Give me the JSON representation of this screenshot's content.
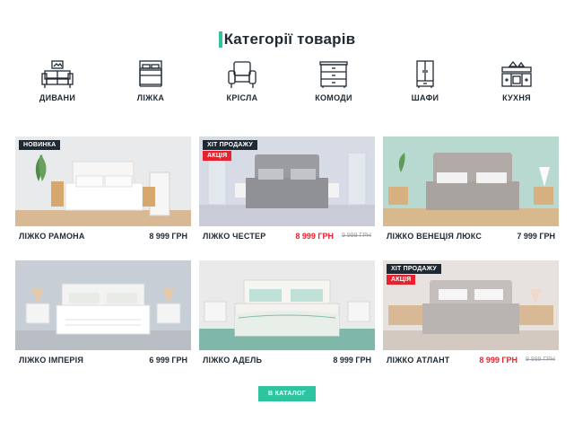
{
  "page": {
    "title": "Категорії товарів",
    "title_first_letter": "К",
    "title_rest": "атегорії товарів"
  },
  "categories": [
    {
      "label": "ДИВАНИ",
      "icon": "sofa-icon"
    },
    {
      "label": "ЛІЖКА",
      "icon": "bed-icon"
    },
    {
      "label": "КРІСЛА",
      "icon": "armchair-icon"
    },
    {
      "label": "КОМОДИ",
      "icon": "dresser-icon"
    },
    {
      "label": "ШАФИ",
      "icon": "wardrobe-icon"
    },
    {
      "label": "КУХНЯ",
      "icon": "kitchen-icon"
    }
  ],
  "products": [
    {
      "name": "ЛІЖКО РАМОНА",
      "price": "8 999 ГРН",
      "old_price": "",
      "badges": [
        "НОВИНКА"
      ],
      "wall": "#e9eaec",
      "bed": "#f2f2f0",
      "floor": "#d9b993"
    },
    {
      "name": "ЛІЖКО ЧЕСТЕР",
      "price": "8 999 ГРН",
      "old_price": "9 999 ГРН",
      "badges": [
        "ХІТ ПРОДАЖУ",
        "АКЦІЯ"
      ],
      "wall": "#d6dbe6",
      "bed": "#8f9196",
      "floor": "#c9ccd6"
    },
    {
      "name": "ЛІЖКО ВЕНЕЦІЯ ЛЮКС",
      "price": "7 999 ГРН",
      "old_price": "",
      "badges": [],
      "wall": "#b8d9cf",
      "bed": "#a9a3a0",
      "floor": "#d8b98d"
    },
    {
      "name": "ЛІЖКО ІМПЕРІЯ",
      "price": "6 999 ГРН",
      "old_price": "",
      "badges": [],
      "wall": "#c7ced5",
      "bed": "#f3f3f3",
      "floor": "#b9bec4"
    },
    {
      "name": "ЛІЖКО АДЕЛЬ",
      "price": "8 999 ГРН",
      "old_price": "",
      "badges": [],
      "wall": "#eaeaea",
      "bed": "#f4f2ee",
      "floor": "#7fb7a8"
    },
    {
      "name": "ЛІЖКО АТЛАНТ",
      "price": "8 999 ГРН",
      "old_price": "9 999 ГРН",
      "badges": [
        "ХІТ ПРОДАЖУ",
        "АКЦІЯ"
      ],
      "wall": "#e8e2de",
      "bed": "#b9b4b2",
      "floor": "#d4c9c1"
    }
  ],
  "catalog_button": {
    "label": "В КАТАЛОГ"
  },
  "colors": {
    "accent": "#2ec4a0",
    "sale": "#e8212e",
    "dark": "#1f2933"
  }
}
